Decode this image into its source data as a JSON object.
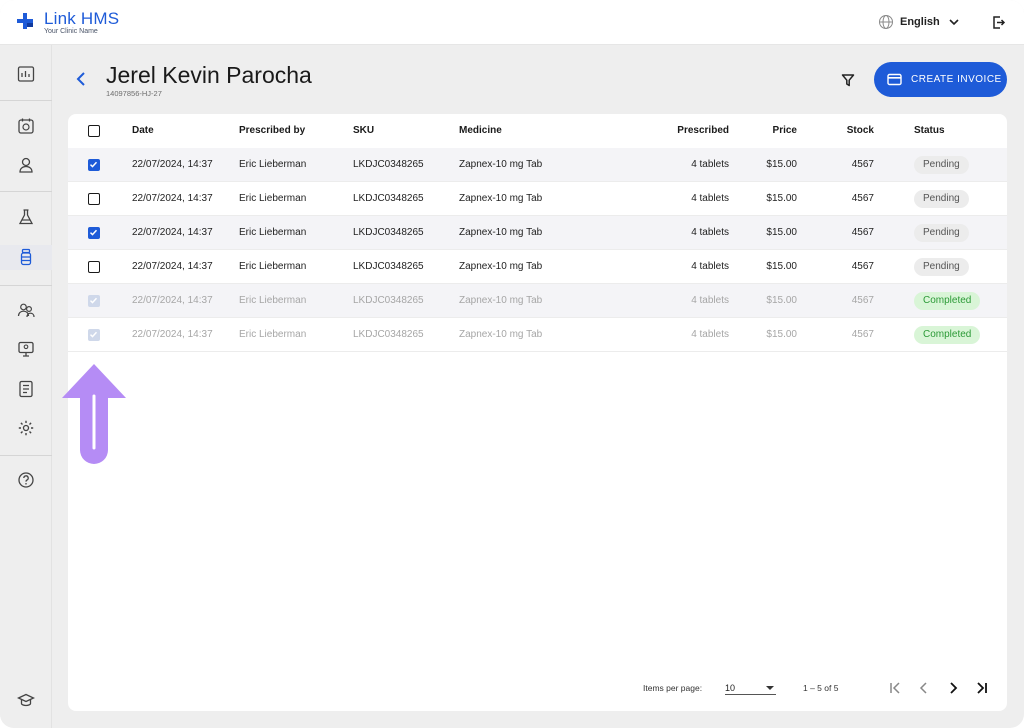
{
  "app": {
    "brand": "Link HMS",
    "clinic": "Your Clinic Name"
  },
  "topbar": {
    "language": "English"
  },
  "patient": {
    "name": "Jerel Kevin Parocha",
    "id": "14097856-HJ-27"
  },
  "actions": {
    "create_invoice": "CREATE INVOICE"
  },
  "table": {
    "headers": {
      "date": "Date",
      "prescribed_by": "Prescribed by",
      "sku": "SKU",
      "medicine": "Medicine",
      "prescribed": "Prescribed",
      "price": "Price",
      "stock": "Stock",
      "status": "Status"
    },
    "rows": [
      {
        "checked": true,
        "disabled": false,
        "date": "22/07/2024, 14:37",
        "prescribed_by": "Eric Lieberman",
        "sku": "LKDJC0348265",
        "medicine": "Zapnex-10 mg Tab",
        "prescribed": "4 tablets",
        "price": "$15.00",
        "stock": "4567",
        "status": "Pending"
      },
      {
        "checked": false,
        "disabled": false,
        "date": "22/07/2024, 14:37",
        "prescribed_by": "Eric Lieberman",
        "sku": "LKDJC0348265",
        "medicine": "Zapnex-10 mg Tab",
        "prescribed": "4 tablets",
        "price": "$15.00",
        "stock": "4567",
        "status": "Pending"
      },
      {
        "checked": true,
        "disabled": false,
        "date": "22/07/2024, 14:37",
        "prescribed_by": "Eric Lieberman",
        "sku": "LKDJC0348265",
        "medicine": "Zapnex-10 mg Tab",
        "prescribed": "4 tablets",
        "price": "$15.00",
        "stock": "4567",
        "status": "Pending"
      },
      {
        "checked": false,
        "disabled": false,
        "date": "22/07/2024, 14:37",
        "prescribed_by": "Eric Lieberman",
        "sku": "LKDJC0348265",
        "medicine": "Zapnex-10 mg Tab",
        "prescribed": "4 tablets",
        "price": "$15.00",
        "stock": "4567",
        "status": "Pending"
      },
      {
        "checked": true,
        "disabled": true,
        "date": "22/07/2024, 14:37",
        "prescribed_by": "Eric Lieberman",
        "sku": "LKDJC0348265",
        "medicine": "Zapnex-10 mg Tab",
        "prescribed": "4 tablets",
        "price": "$15.00",
        "stock": "4567",
        "status": "Completed"
      },
      {
        "checked": true,
        "disabled": true,
        "date": "22/07/2024, 14:37",
        "prescribed_by": "Eric Lieberman",
        "sku": "LKDJC0348265",
        "medicine": "Zapnex-10 mg Tab",
        "prescribed": "4 tablets",
        "price": "$15.00",
        "stock": "4567",
        "status": "Completed"
      }
    ]
  },
  "pagination": {
    "items_per_page_label": "Items per page:",
    "items_per_page": "10",
    "range": "1 – 5 of 5"
  },
  "icons": {
    "sidebar": [
      "dashboard-icon",
      "calendar-icon",
      "person-icon",
      "lab-flask-icon",
      "medicine-bottle-icon",
      "patients-group-icon",
      "monitor-icon",
      "report-icon",
      "settings-gear-icon",
      "help-icon",
      "graduation-cap-icon"
    ],
    "overlay": "up-arrow-annotation-icon"
  },
  "colors": {
    "accent": "#1e5bd8",
    "pending_bg": "#ececec",
    "completed_bg": "#d9f5d7",
    "completed_text": "#2c9a37",
    "annotation": "#b58cf5"
  }
}
